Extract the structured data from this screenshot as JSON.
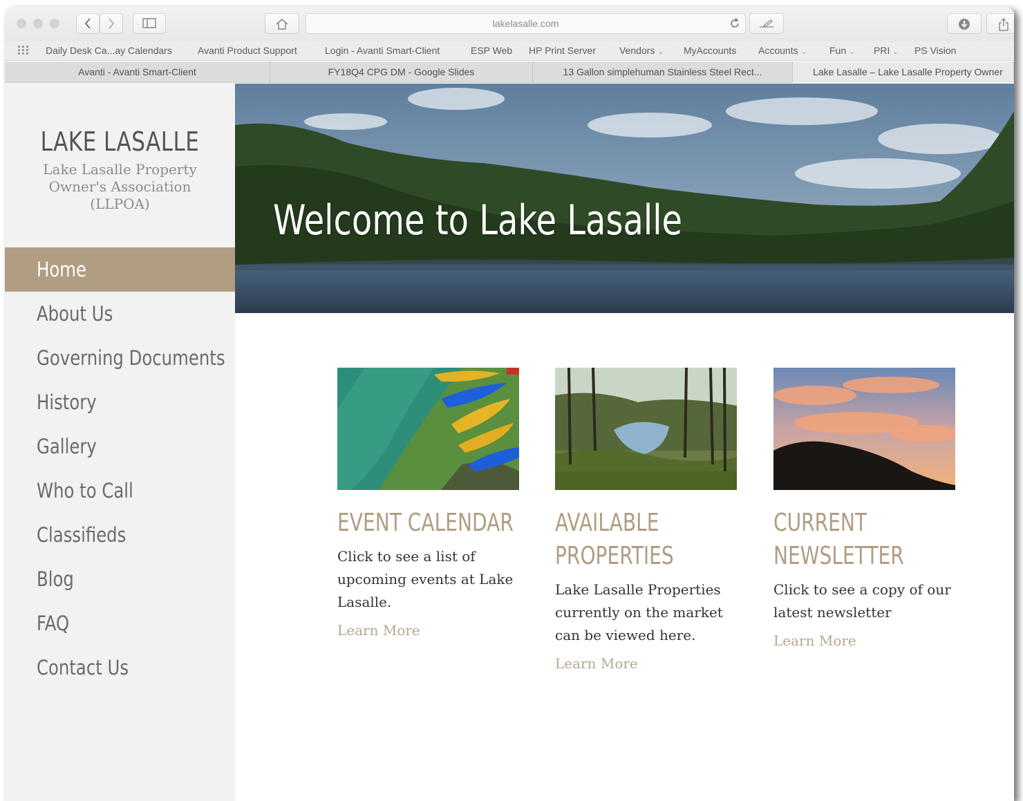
{
  "browser": {
    "url": "lakelasalle.com",
    "bookmarks": [
      {
        "label": "Daily Desk Ca...ay Calendars",
        "has_menu": false
      },
      {
        "label": "Avanti Product Support",
        "has_menu": false
      },
      {
        "label": "Login - Avanti Smart-Client",
        "has_menu": false
      },
      {
        "label": "ESP Web",
        "has_menu": false
      },
      {
        "label": "HP Print Server",
        "has_menu": false
      },
      {
        "label": "Vendors",
        "has_menu": true
      },
      {
        "label": "MyAccounts",
        "has_menu": false
      },
      {
        "label": "Accounts",
        "has_menu": true
      },
      {
        "label": "Fun",
        "has_menu": true
      },
      {
        "label": "PRI",
        "has_menu": true
      },
      {
        "label": "PS Vision",
        "has_menu": false
      }
    ],
    "tabs": [
      {
        "label": "Avanti - Avanti Smart-Client",
        "active": false
      },
      {
        "label": "FY18Q4 CPG DM - Google Slides",
        "active": false
      },
      {
        "label": "13 Gallon simplehuman Stainless Steel Rect...",
        "active": false
      },
      {
        "label": "Lake Lasalle – Lake Lasalle Property Owner",
        "active": true
      }
    ]
  },
  "sidebar": {
    "site_title": "LAKE LASALLE",
    "tagline": "Lake Lasalle Property Owner's Association (LLPOA)",
    "nav": [
      {
        "label": "Home",
        "active": true
      },
      {
        "label": "About Us",
        "active": false
      },
      {
        "label": "Governing Documents",
        "active": false
      },
      {
        "label": "History",
        "active": false
      },
      {
        "label": "Gallery",
        "active": false
      },
      {
        "label": "Who to Call",
        "active": false
      },
      {
        "label": "Classifieds",
        "active": false
      },
      {
        "label": "Blog",
        "active": false
      },
      {
        "label": "FAQ",
        "active": false
      },
      {
        "label": "Contact Us",
        "active": false
      }
    ]
  },
  "hero": {
    "title": "Welcome to Lake Lasalle"
  },
  "cards": [
    {
      "title": "EVENT CALENDAR",
      "text": "Click to see a list of upcoming events at Lake Lasalle.",
      "link": "Learn More"
    },
    {
      "title": "AVAILABLE PROPERTIES",
      "text": "Lake Lasalle Properties currently on the market can be viewed here.",
      "link": "Learn More"
    },
    {
      "title": "CURRENT NEWSLETTER",
      "text": "Click to see a copy of our latest newsletter",
      "link": "Learn More"
    }
  ],
  "colors": {
    "accent": "#b09d82",
    "sidebar_bg": "#f2f2f2",
    "link": "#b6a890"
  }
}
